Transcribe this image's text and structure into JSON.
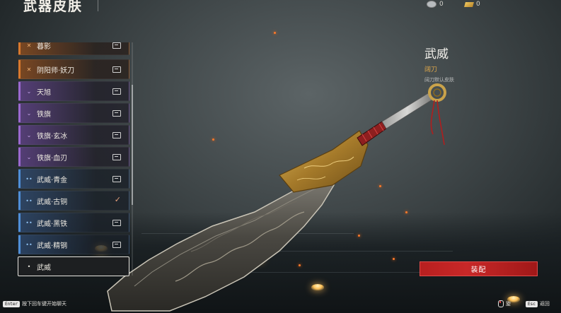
{
  "header": {
    "title": "武器皮肤",
    "currency_silver": "0",
    "currency_gold": "0"
  },
  "skins": [
    {
      "label": "暮影",
      "rarity": "orange",
      "rarity_icon": "crossed-swords-icon",
      "status_icon": "chat-icon"
    },
    {
      "label": "阴阳师·妖刀",
      "rarity": "orange",
      "rarity_icon": "crossed-swords-icon",
      "status_icon": "chat-icon"
    },
    {
      "label": "天旭",
      "rarity": "purple",
      "rarity_icon": "chevron-icon",
      "status_icon": "chat-icon"
    },
    {
      "label": "铁旗",
      "rarity": "purple",
      "rarity_icon": "chevron-icon",
      "status_icon": "chat-icon"
    },
    {
      "label": "铁旗·玄冰",
      "rarity": "purple",
      "rarity_icon": "chevron-icon",
      "status_icon": "chat-icon"
    },
    {
      "label": "铁旗·血刃",
      "rarity": "purple",
      "rarity_icon": "chevron-icon",
      "status_icon": "chat-icon"
    },
    {
      "label": "武威·青金",
      "rarity": "blue",
      "rarity_icon": "double-dot-icon",
      "status_icon": "chat-icon"
    },
    {
      "label": "武威·古铜",
      "rarity": "blue",
      "rarity_icon": "double-dot-icon",
      "status_icon": "check-icon"
    },
    {
      "label": "武威·黑铁",
      "rarity": "blue",
      "rarity_icon": "double-dot-icon",
      "status_icon": "chat-icon"
    },
    {
      "label": "武威·精钢",
      "rarity": "blue",
      "rarity_icon": "double-dot-icon",
      "status_icon": "chat-icon"
    },
    {
      "label": "武威",
      "rarity": "white",
      "rarity_icon": "dot-icon",
      "status_icon": "none",
      "selected": true
    }
  ],
  "details": {
    "skin_name": "武威",
    "weapon_type": "阔刀",
    "description": "阔刀默认皮肤",
    "equip_label": "装配"
  },
  "footer": {
    "chat_key": "Enter",
    "chat_hint": "按下回车键开始聊天",
    "preview_hint": "旋",
    "back_key": "Esc",
    "back_hint": "返回"
  },
  "colors": {
    "accent_red": "#c82828",
    "orange": "#d87a2e",
    "purple": "#9b6ad0",
    "blue": "#4f8fd8",
    "gold_text": "#e0a84a"
  }
}
